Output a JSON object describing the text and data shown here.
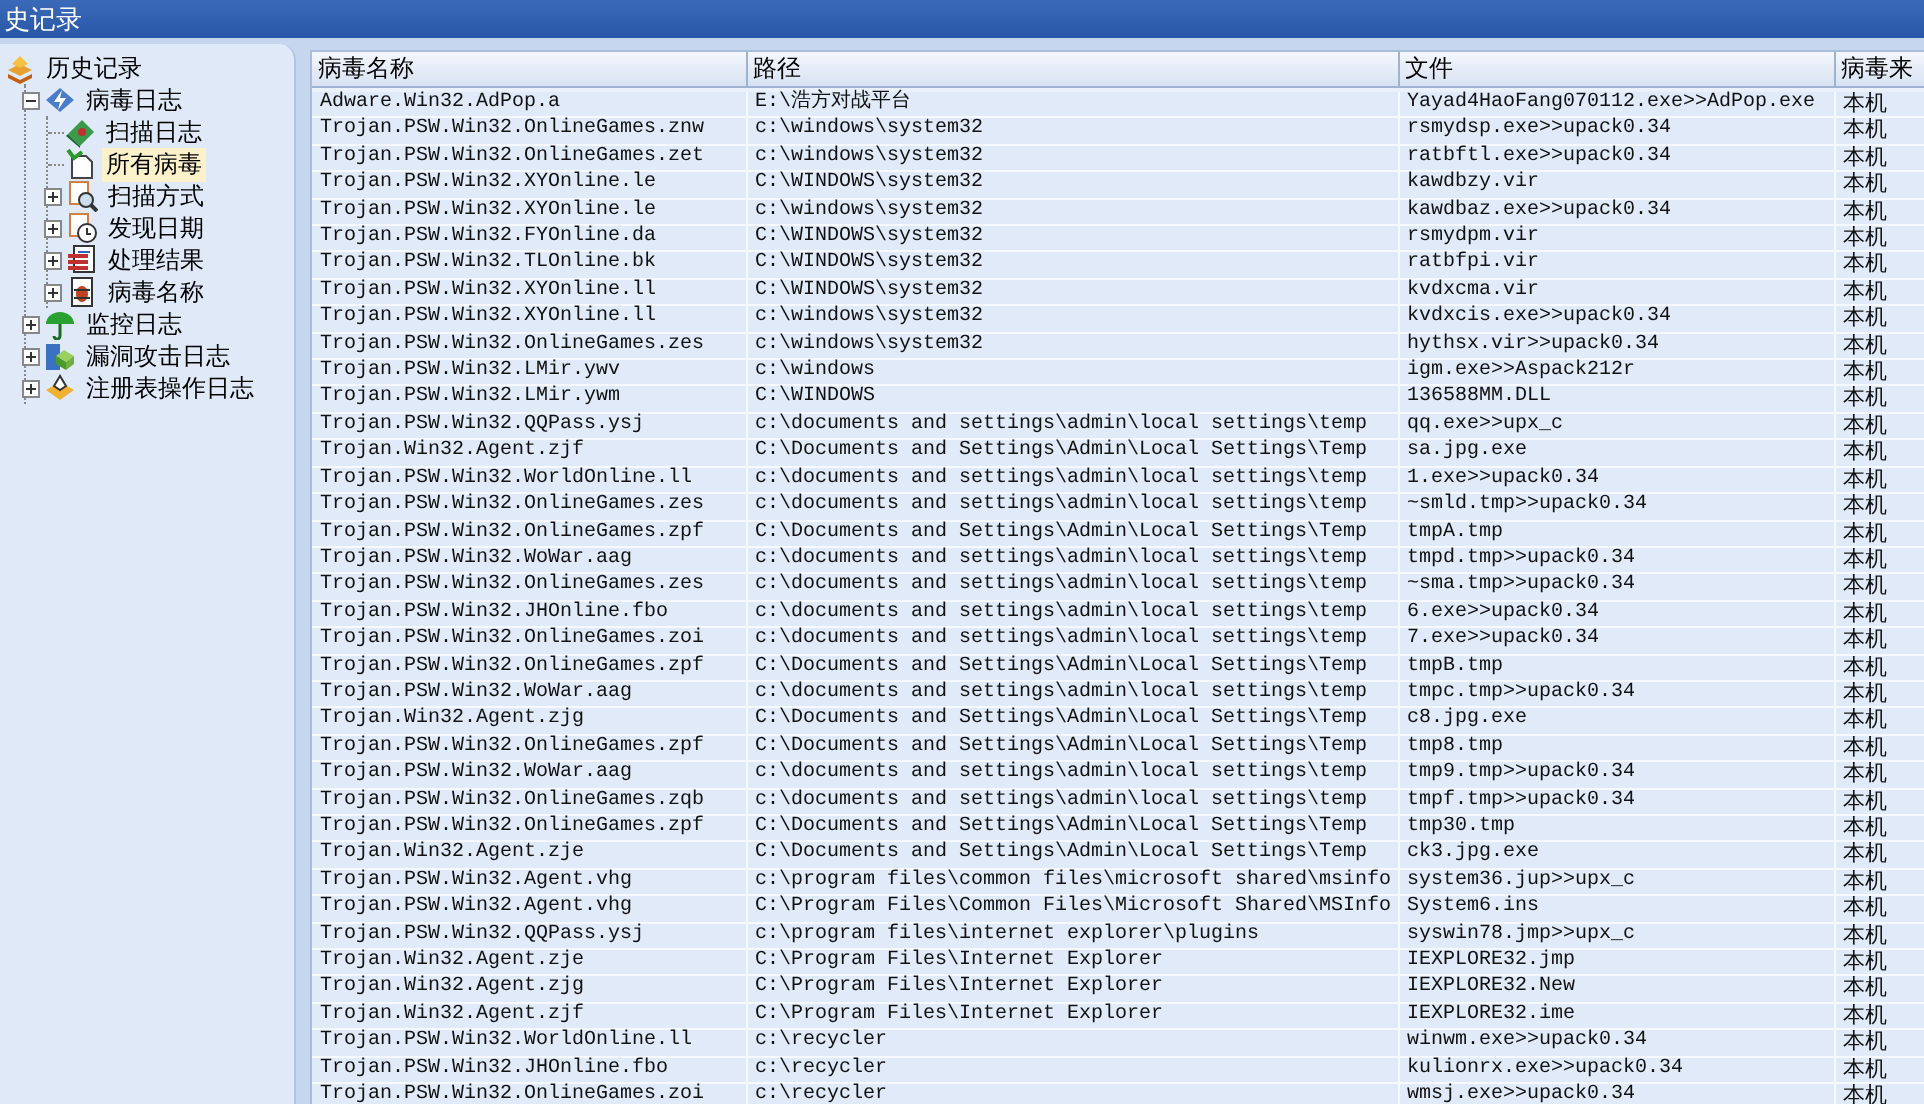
{
  "window": {
    "title": "史记录"
  },
  "tree": {
    "label": "历史记录",
    "selected": false,
    "children": [
      {
        "label": "病毒日志",
        "selected": false,
        "expanded": true,
        "children": [
          {
            "label": "扫描日志",
            "selected": false
          },
          {
            "label": "所有病毒",
            "selected": true
          },
          {
            "label": "扫描方式",
            "selected": false,
            "expanded": false
          },
          {
            "label": "发现日期",
            "selected": false,
            "expanded": false
          },
          {
            "label": "处理结果",
            "selected": false,
            "expanded": false
          },
          {
            "label": "病毒名称",
            "selected": false,
            "expanded": false
          }
        ]
      },
      {
        "label": "监控日志",
        "selected": false,
        "expanded": false
      },
      {
        "label": "漏洞攻击日志",
        "selected": false,
        "expanded": false
      },
      {
        "label": "注册表操作日志",
        "selected": false,
        "expanded": false
      }
    ]
  },
  "table": {
    "columns": [
      "病毒名称",
      "路径",
      "文件",
      "病毒来"
    ],
    "rows": [
      [
        "Adware.Win32.AdPop.a",
        "E:\\浩方对战平台",
        "Yayad4HaoFang070112.exe>>AdPop.exe",
        "本机"
      ],
      [
        "Trojan.PSW.Win32.OnlineGames.znw",
        "c:\\windows\\system32",
        "rsmydsp.exe>>upack0.34",
        "本机"
      ],
      [
        "Trojan.PSW.Win32.OnlineGames.zet",
        "c:\\windows\\system32",
        "ratbftl.exe>>upack0.34",
        "本机"
      ],
      [
        "Trojan.PSW.Win32.XYOnline.le",
        "C:\\WINDOWS\\system32",
        "kawdbzy.vir",
        "本机"
      ],
      [
        "Trojan.PSW.Win32.XYOnline.le",
        "c:\\windows\\system32",
        "kawdbaz.exe>>upack0.34",
        "本机"
      ],
      [
        "Trojan.PSW.Win32.FYOnline.da",
        "C:\\WINDOWS\\system32",
        "rsmydpm.vir",
        "本机"
      ],
      [
        "Trojan.PSW.Win32.TLOnline.bk",
        "C:\\WINDOWS\\system32",
        "ratbfpi.vir",
        "本机"
      ],
      [
        "Trojan.PSW.Win32.XYOnline.ll",
        "C:\\WINDOWS\\system32",
        "kvdxcma.vir",
        "本机"
      ],
      [
        "Trojan.PSW.Win32.XYOnline.ll",
        "c:\\windows\\system32",
        "kvdxcis.exe>>upack0.34",
        "本机"
      ],
      [
        "Trojan.PSW.Win32.OnlineGames.zes",
        "c:\\windows\\system32",
        "hythsx.vir>>upack0.34",
        "本机"
      ],
      [
        "Trojan.PSW.Win32.LMir.ywv",
        "c:\\windows",
        "igm.exe>>Aspack212r",
        "本机"
      ],
      [
        "Trojan.PSW.Win32.LMir.ywm",
        "C:\\WINDOWS",
        "136588MM.DLL",
        "本机"
      ],
      [
        "Trojan.PSW.Win32.QQPass.ysj",
        "c:\\documents and settings\\admin\\local settings\\temp",
        "qq.exe>>upx_c",
        "本机"
      ],
      [
        "Trojan.Win32.Agent.zjf",
        "C:\\Documents and Settings\\Admin\\Local Settings\\Temp",
        "sa.jpg.exe",
        "本机"
      ],
      [
        "Trojan.PSW.Win32.WorldOnline.ll",
        "c:\\documents and settings\\admin\\local settings\\temp",
        "1.exe>>upack0.34",
        "本机"
      ],
      [
        "Trojan.PSW.Win32.OnlineGames.zes",
        "c:\\documents and settings\\admin\\local settings\\temp",
        "~smld.tmp>>upack0.34",
        "本机"
      ],
      [
        "Trojan.PSW.Win32.OnlineGames.zpf",
        "C:\\Documents and Settings\\Admin\\Local Settings\\Temp",
        "tmpA.tmp",
        "本机"
      ],
      [
        "Trojan.PSW.Win32.WoWar.aag",
        "c:\\documents and settings\\admin\\local settings\\temp",
        "tmpd.tmp>>upack0.34",
        "本机"
      ],
      [
        "Trojan.PSW.Win32.OnlineGames.zes",
        "c:\\documents and settings\\admin\\local settings\\temp",
        "~sma.tmp>>upack0.34",
        "本机"
      ],
      [
        "Trojan.PSW.Win32.JHOnline.fbo",
        "c:\\documents and settings\\admin\\local settings\\temp",
        "6.exe>>upack0.34",
        "本机"
      ],
      [
        "Trojan.PSW.Win32.OnlineGames.zoi",
        "c:\\documents and settings\\admin\\local settings\\temp",
        "7.exe>>upack0.34",
        "本机"
      ],
      [
        "Trojan.PSW.Win32.OnlineGames.zpf",
        "C:\\Documents and Settings\\Admin\\Local Settings\\Temp",
        "tmpB.tmp",
        "本机"
      ],
      [
        "Trojan.PSW.Win32.WoWar.aag",
        "c:\\documents and settings\\admin\\local settings\\temp",
        "tmpc.tmp>>upack0.34",
        "本机"
      ],
      [
        "Trojan.Win32.Agent.zjg",
        "C:\\Documents and Settings\\Admin\\Local Settings\\Temp",
        "c8.jpg.exe",
        "本机"
      ],
      [
        "Trojan.PSW.Win32.OnlineGames.zpf",
        "C:\\Documents and Settings\\Admin\\Local Settings\\Temp",
        "tmp8.tmp",
        "本机"
      ],
      [
        "Trojan.PSW.Win32.WoWar.aag",
        "c:\\documents and settings\\admin\\local settings\\temp",
        "tmp9.tmp>>upack0.34",
        "本机"
      ],
      [
        "Trojan.PSW.Win32.OnlineGames.zqb",
        "c:\\documents and settings\\admin\\local settings\\temp",
        "tmpf.tmp>>upack0.34",
        "本机"
      ],
      [
        "Trojan.PSW.Win32.OnlineGames.zpf",
        "C:\\Documents and Settings\\Admin\\Local Settings\\Temp",
        "tmp30.tmp",
        "本机"
      ],
      [
        "Trojan.Win32.Agent.zje",
        "C:\\Documents and Settings\\Admin\\Local Settings\\Temp",
        "ck3.jpg.exe",
        "本机"
      ],
      [
        "Trojan.PSW.Win32.Agent.vhg",
        "c:\\program files\\common files\\microsoft shared\\msinfo",
        "system36.jup>>upx_c",
        "本机"
      ],
      [
        "Trojan.PSW.Win32.Agent.vhg",
        "C:\\Program Files\\Common Files\\Microsoft Shared\\MSInfo",
        "System6.ins",
        "本机"
      ],
      [
        "Trojan.PSW.Win32.QQPass.ysj",
        "c:\\program files\\internet explorer\\plugins",
        "syswin78.jmp>>upx_c",
        "本机"
      ],
      [
        "Trojan.Win32.Agent.zje",
        "C:\\Program Files\\Internet Explorer",
        "IEXPLORE32.jmp",
        "本机"
      ],
      [
        "Trojan.Win32.Agent.zjg",
        "C:\\Program Files\\Internet Explorer",
        "IEXPLORE32.New",
        "本机"
      ],
      [
        "Trojan.Win32.Agent.zjf",
        "C:\\Program Files\\Internet Explorer",
        "IEXPLORE32.ime",
        "本机"
      ],
      [
        "Trojan.PSW.Win32.WorldOnline.ll",
        "c:\\recycler",
        "winwm.exe>>upack0.34",
        "本机"
      ],
      [
        "Trojan.PSW.Win32.JHOnline.fbo",
        "c:\\recycler",
        "kulionrx.exe>>upack0.34",
        "本机"
      ],
      [
        "Trojan.PSW.Win32.OnlineGames.zoi",
        "c:\\recycler",
        "wmsj.exe>>upack0.34",
        "本机"
      ]
    ]
  }
}
